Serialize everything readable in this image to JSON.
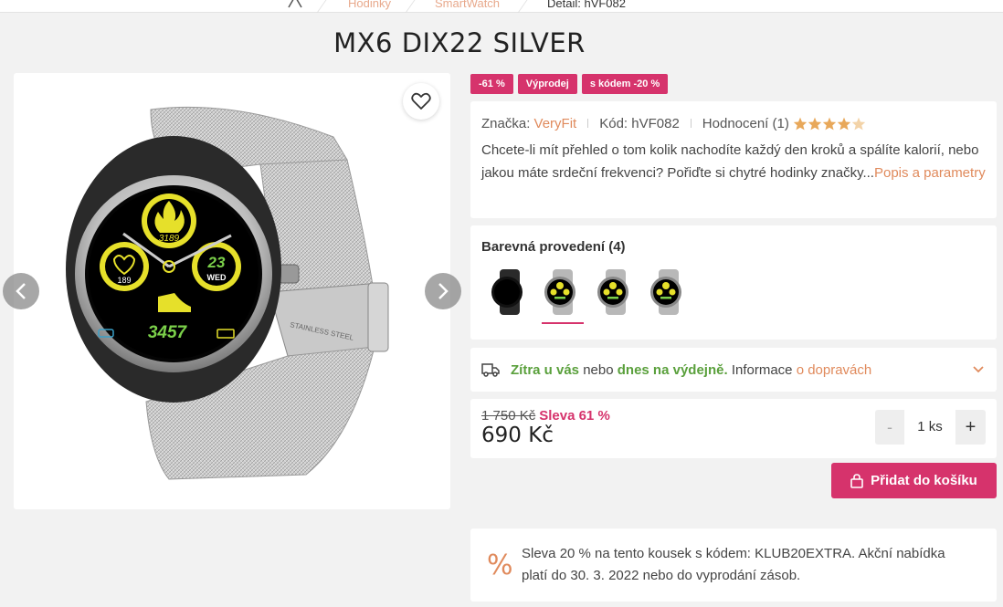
{
  "breadcrumb": {
    "items": [
      "Hodinky",
      "SmartWatch",
      "Detail: hVF082"
    ]
  },
  "product": {
    "title": "MX6 DIX22 SILVER",
    "badges": [
      "-61 %",
      "Výprodej",
      "s kódem -20 %"
    ],
    "brand_label": "Značka:",
    "brand": "VeryFit",
    "code_label": "Kód:",
    "code": "hVF082",
    "rating_label": "Hodnocení (1)",
    "rating": 4,
    "rating_max": 5,
    "description": "Chcete-li mít přehled o tom kolik nachodíte každý den kroků a spálíte kalorií, nebo jakou máte srdeční frekvenci? Pořiďte si chytré hodinky značky...",
    "description_link": "Popis a parametry",
    "image_text": {
      "top_number": "3189",
      "left_number": "189",
      "right_number": "23",
      "right_day": "WED",
      "steps": "3457",
      "band_text": "STAINLESS STEEL"
    }
  },
  "variants": {
    "title": "Barevná provedení (4)",
    "items": [
      {
        "name": "black-watch",
        "band": "#2a2a2a"
      },
      {
        "name": "silver-watch-1",
        "band": "#b8b8b8"
      },
      {
        "name": "silver-watch-2",
        "band": "#b8b8b8"
      },
      {
        "name": "silver-watch-3",
        "band": "#b8b8b8"
      }
    ],
    "active_index": 1
  },
  "delivery": {
    "part1": "Zítra u vás",
    "part2": "nebo",
    "part3": "dnes na výdejně.",
    "part4": "Informace",
    "link": "o dopravách"
  },
  "price": {
    "old": "1 750 Kč",
    "discount": "Sleva 61 %",
    "current": "690 Kč",
    "qty_minus": "-",
    "qty_value": "1 ks",
    "qty_plus": "+",
    "cart_label": "Přidat do košíku"
  },
  "promo": {
    "icon": "%",
    "text_line1": "Sleva 20 % na tento kousek s kódem: KLUB20EXTRA. Akční nabídka",
    "text_line2": "platí do 30. 3. 2022 nebo do vyprodání zásob."
  },
  "colors": {
    "accent": "#d6336c",
    "link": "#e08a5c",
    "green": "#5aa03c",
    "star": "#e8a85a"
  }
}
